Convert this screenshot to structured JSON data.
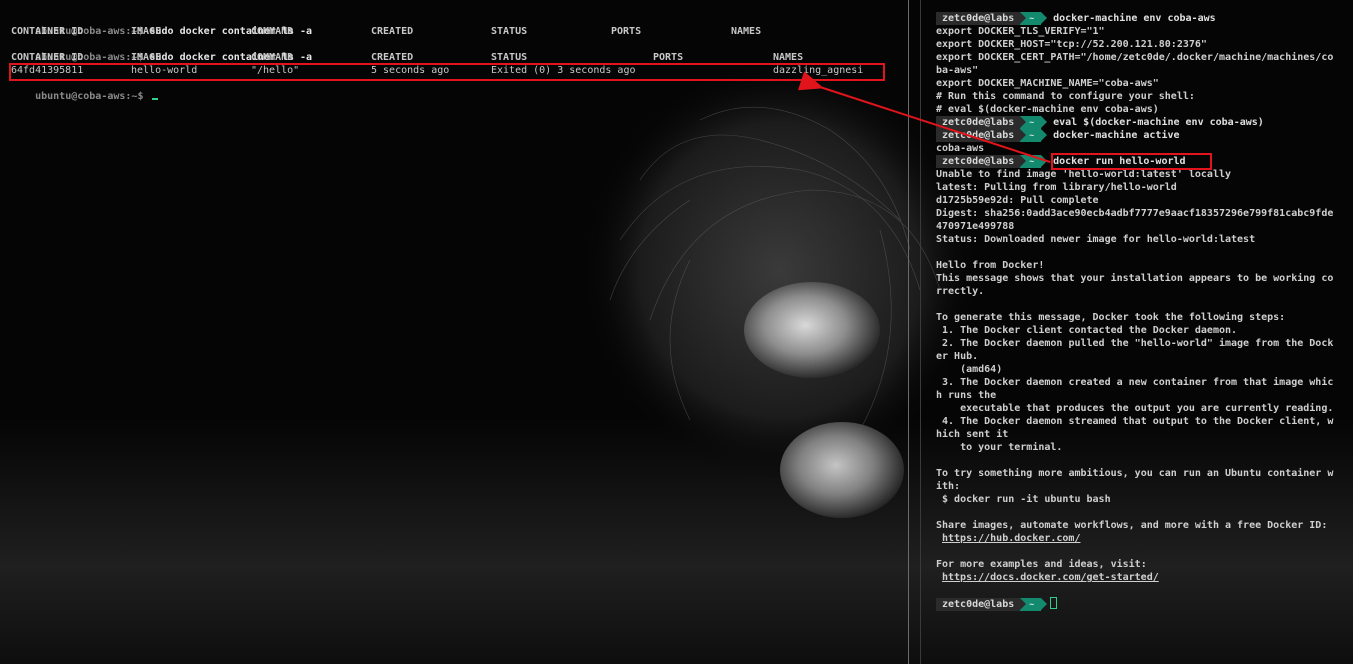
{
  "left_terminal": {
    "prompt": "ubuntu@coba-aws:~$",
    "command1": "sudo docker container ls -a",
    "headers1": [
      "CONTAINER ID",
      "IMAGE",
      "COMMAND",
      "CREATED",
      "STATUS",
      "PORTS",
      "NAMES"
    ],
    "command2": "sudo docker container ls -a",
    "headers2": [
      "CONTAINER ID",
      "IMAGE",
      "COMMAND",
      "CREATED",
      "STATUS",
      "PORTS",
      "NAMES"
    ],
    "row": {
      "container_id": "64fd41395811",
      "image": "hello-world",
      "command": "\"/hello\"",
      "created": "5 seconds ago",
      "status": "Exited (0) 3 seconds ago",
      "ports": "",
      "names": "dazzling_agnesi"
    },
    "prompt3": "ubuntu@coba-aws:~$"
  },
  "right_terminal": {
    "prompt_user": "zetc0de@labs",
    "prompt_dir": "~",
    "lines": [
      {
        "type": "prompt",
        "cmd": "docker-machine env coba-aws"
      },
      {
        "type": "text",
        "text": "export DOCKER_TLS_VERIFY=\"1\""
      },
      {
        "type": "text",
        "text": "export DOCKER_HOST=\"tcp://52.200.121.80:2376\""
      },
      {
        "type": "text",
        "text": "export DOCKER_CERT_PATH=\"/home/zetc0de/.docker/machine/machines/co"
      },
      {
        "type": "text",
        "text": "ba-aws\""
      },
      {
        "type": "text",
        "text": "export DOCKER_MACHINE_NAME=\"coba-aws\""
      },
      {
        "type": "text",
        "text": "# Run this command to configure your shell:"
      },
      {
        "type": "text",
        "text": "# eval $(docker-machine env coba-aws)"
      },
      {
        "type": "prompt",
        "cmd": "eval $(docker-machine env coba-aws)"
      },
      {
        "type": "prompt",
        "cmd": "docker-machine active"
      },
      {
        "type": "text",
        "text": "coba-aws"
      },
      {
        "type": "prompt",
        "cmd": "docker run hello-world"
      },
      {
        "type": "text",
        "text": "Unable to find image 'hello-world:latest' locally"
      },
      {
        "type": "text",
        "text": "latest: Pulling from library/hello-world"
      },
      {
        "type": "text",
        "text": "d1725b59e92d: Pull complete"
      },
      {
        "type": "text",
        "text": "Digest: sha256:0add3ace90ecb4adbf7777e9aacf18357296e799f81cabc9fde"
      },
      {
        "type": "text",
        "text": "470971e499788"
      },
      {
        "type": "text",
        "text": "Status: Downloaded newer image for hello-world:latest"
      },
      {
        "type": "text",
        "text": ""
      },
      {
        "type": "text",
        "text": "Hello from Docker!"
      },
      {
        "type": "text",
        "text": "This message shows that your installation appears to be working co"
      },
      {
        "type": "text",
        "text": "rrectly."
      },
      {
        "type": "text",
        "text": ""
      },
      {
        "type": "text",
        "text": "To generate this message, Docker took the following steps:"
      },
      {
        "type": "text",
        "text": " 1. The Docker client contacted the Docker daemon."
      },
      {
        "type": "text",
        "text": " 2. The Docker daemon pulled the \"hello-world\" image from the Dock"
      },
      {
        "type": "text",
        "text": "er Hub."
      },
      {
        "type": "text",
        "text": "    (amd64)"
      },
      {
        "type": "text",
        "text": " 3. The Docker daemon created a new container from that image whic"
      },
      {
        "type": "text",
        "text": "h runs the"
      },
      {
        "type": "text",
        "text": "    executable that produces the output you are currently reading."
      },
      {
        "type": "text",
        "text": " 4. The Docker daemon streamed that output to the Docker client, w"
      },
      {
        "type": "text",
        "text": "hich sent it"
      },
      {
        "type": "text",
        "text": "    to your terminal."
      },
      {
        "type": "text",
        "text": ""
      },
      {
        "type": "text",
        "text": "To try something more ambitious, you can run an Ubuntu container w"
      },
      {
        "type": "text",
        "text": "ith:"
      },
      {
        "type": "text",
        "text": " $ docker run -it ubuntu bash"
      },
      {
        "type": "text",
        "text": ""
      },
      {
        "type": "text",
        "text": "Share images, automate workflows, and more with a free Docker ID:"
      },
      {
        "type": "link",
        "text": "https://hub.docker.com/"
      },
      {
        "type": "text",
        "text": ""
      },
      {
        "type": "text",
        "text": "For more examples and ideas, visit:"
      },
      {
        "type": "link",
        "text": "https://docs.docker.com/get-started/"
      },
      {
        "type": "text",
        "text": ""
      },
      {
        "type": "prompt",
        "cmd": ""
      }
    ]
  },
  "colors": {
    "annotation": "#e0141a",
    "prompt_dir_bg": "#138a6e",
    "cursor": "#2fd08a"
  }
}
